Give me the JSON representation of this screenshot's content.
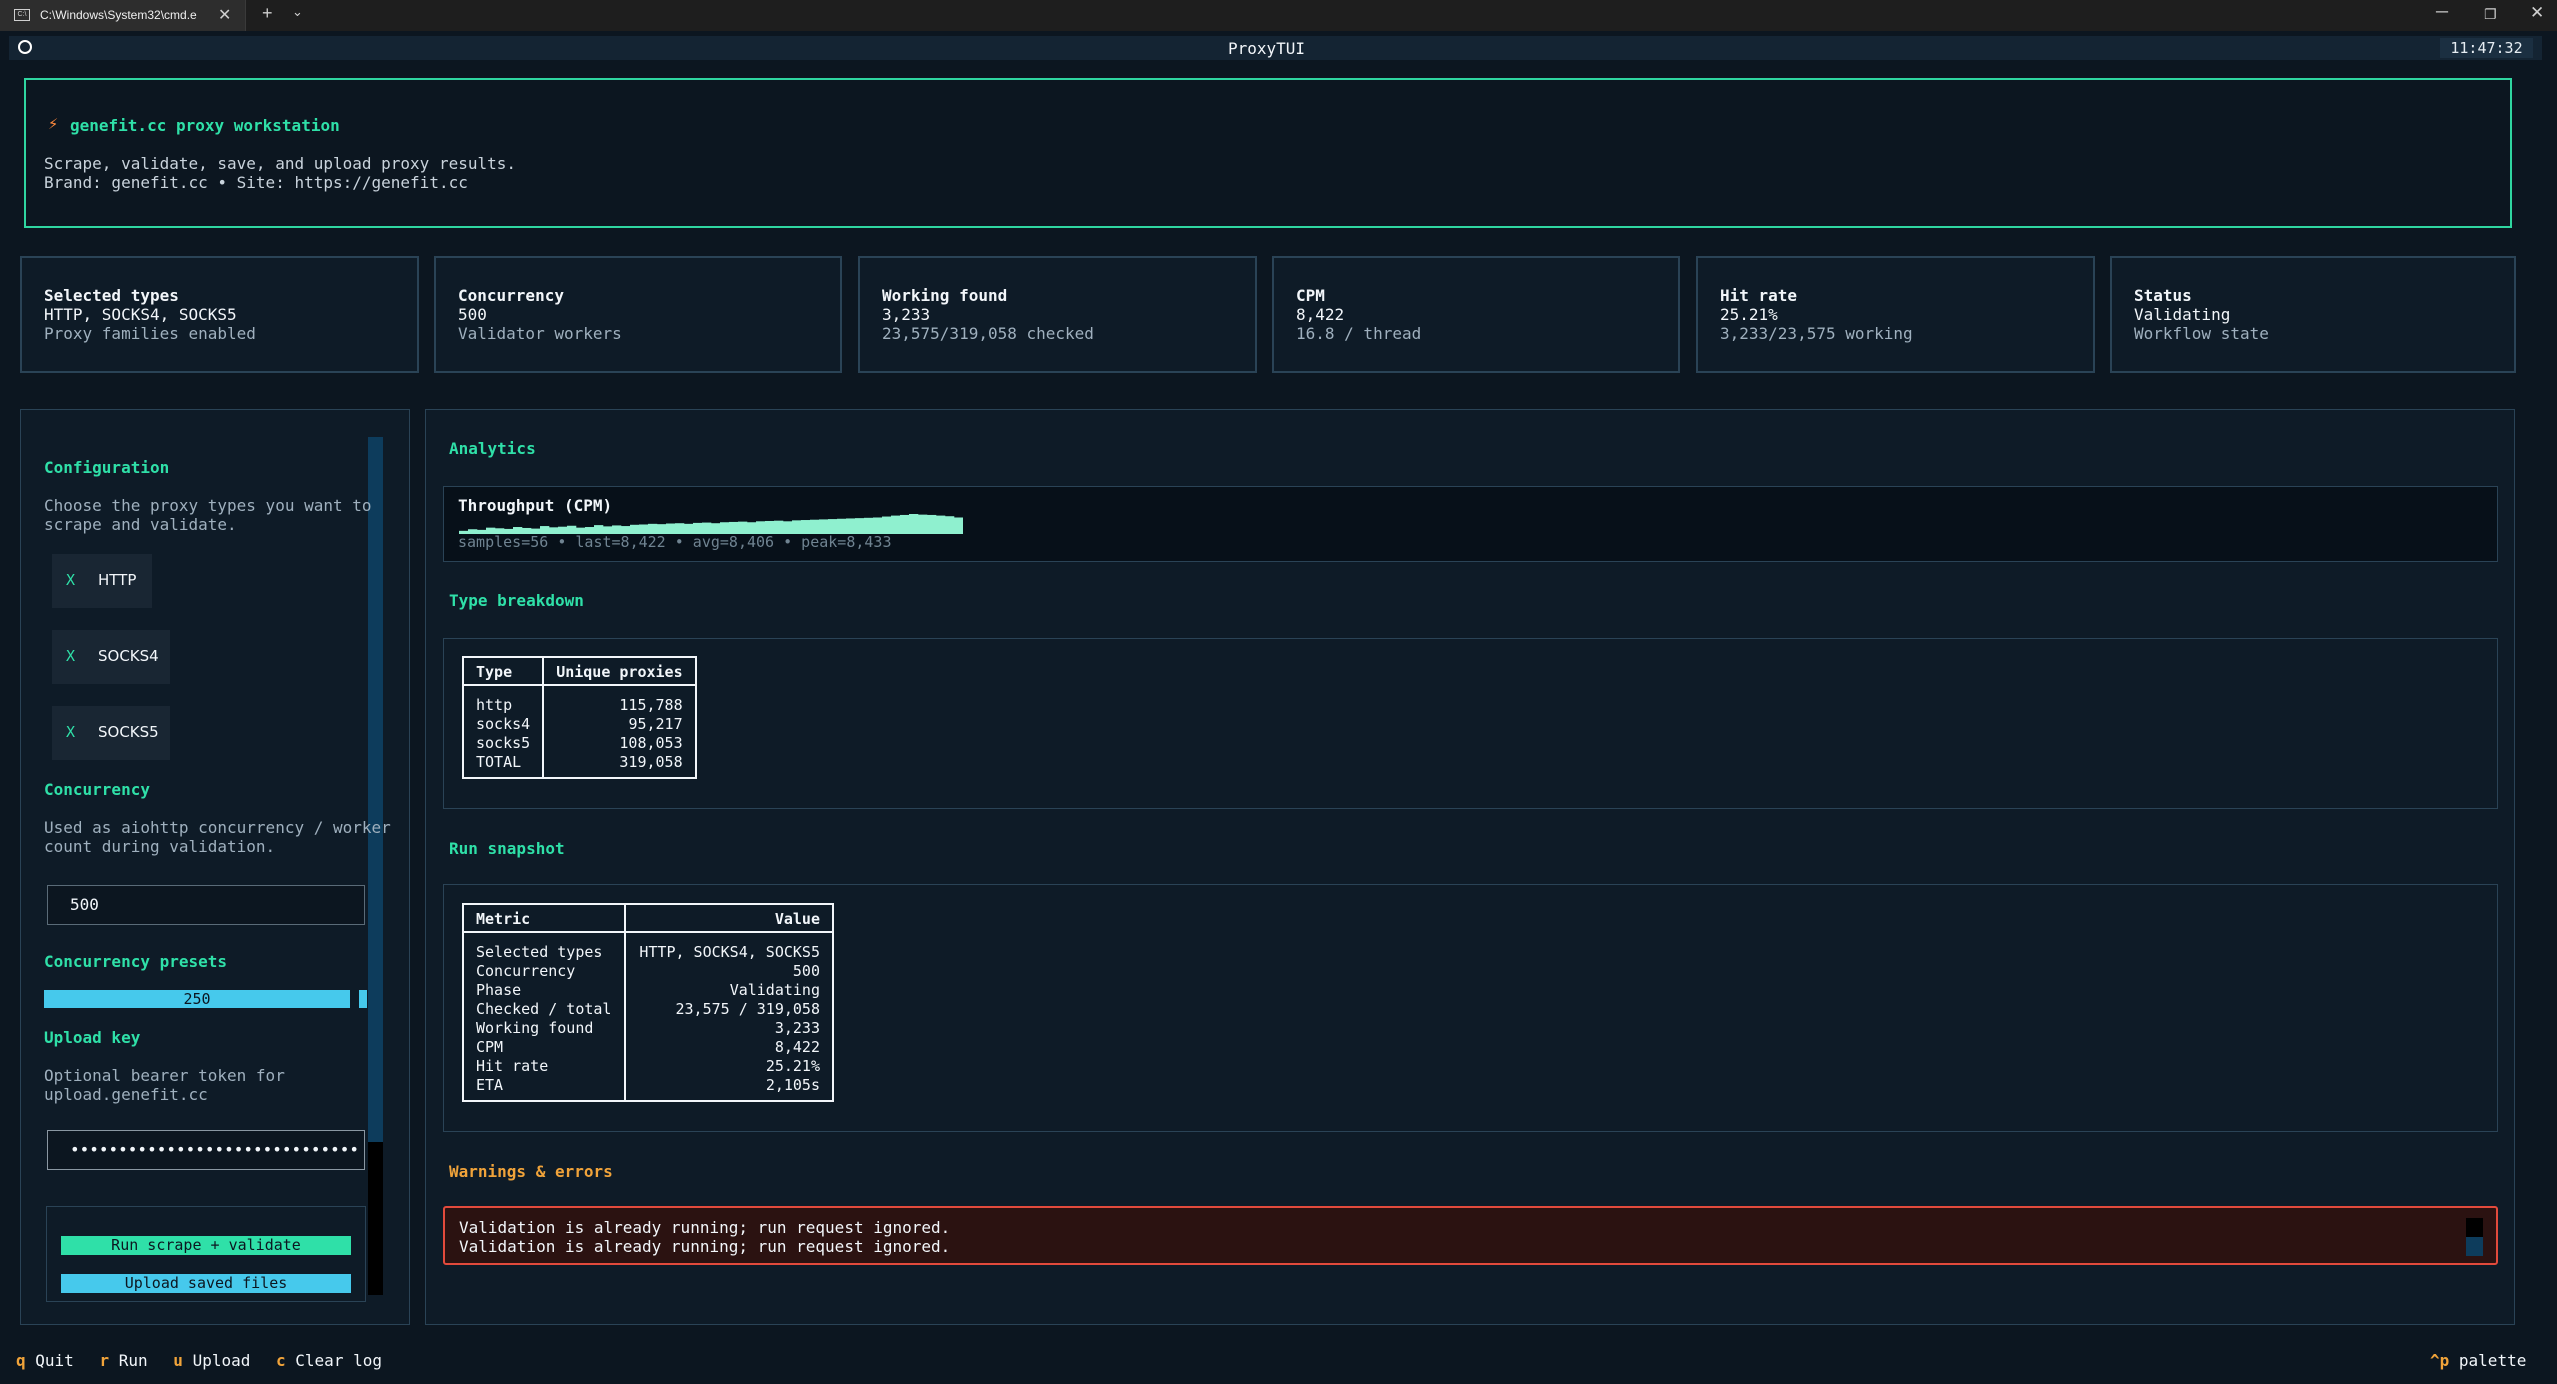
{
  "window": {
    "tab_title": "C:\\Windows\\System32\\cmd.e",
    "tab_icon": "terminal-icon",
    "new_tab": "+",
    "dropdown": "⌄",
    "close_tab": "✕",
    "minimize": "─",
    "maximize": "❐",
    "close": "✕"
  },
  "header": {
    "title": "ProxyTUI",
    "clock": "11:47:32"
  },
  "hero": {
    "bolt": "⚡",
    "title": "genefit.cc proxy workstation",
    "line1": "Scrape, validate, save, and upload proxy results.",
    "line2": "Brand: genefit.cc • Site: https://genefit.cc"
  },
  "stats": [
    {
      "title": "Selected types",
      "value": "HTTP, SOCKS4, SOCKS5",
      "sub": "Proxy families enabled"
    },
    {
      "title": "Concurrency",
      "value": "500",
      "sub": "Validator workers"
    },
    {
      "title": "Working found",
      "value": "3,233",
      "sub": "23,575/319,058 checked"
    },
    {
      "title": "CPM",
      "value": "8,422",
      "sub": "16.8 / thread"
    },
    {
      "title": "Hit rate",
      "value": "25.21%",
      "sub": "3,233/23,575 working"
    },
    {
      "title": "Status",
      "value": "Validating",
      "sub": "Workflow state"
    }
  ],
  "sidebar": {
    "config_title": "Configuration",
    "config_desc1": "Choose the proxy types you want to",
    "config_desc2": "scrape and validate.",
    "types": [
      {
        "mark": "X",
        "label": "HTTP"
      },
      {
        "mark": "X",
        "label": "SOCKS4"
      },
      {
        "mark": "X",
        "label": "SOCKS5"
      }
    ],
    "concurrency_title": "Concurrency",
    "concurrency_desc1": "Used as aiohttp concurrency / worker",
    "concurrency_desc2": "count during validation.",
    "concurrency_value": "500",
    "presets_title": "Concurrency presets",
    "preset_value": "250",
    "upload_key_title": "Upload key",
    "upload_key_desc1": "Optional bearer token for",
    "upload_key_desc2": "upload.genefit.cc",
    "upload_key_value": "••••••••••••••••••••••••••••••",
    "run_button": "Run scrape + validate",
    "upload_button": "Upload saved files"
  },
  "analytics": {
    "title": "Analytics",
    "throughput_title": "Throughput (CPM)",
    "throughput_stats": "samples=56 • last=8,422 • avg=8,406 • peak=8,433",
    "type_breakdown_title": "Type breakdown",
    "type_table": {
      "headers": [
        "Type",
        "Unique proxies"
      ],
      "rows": [
        [
          "http",
          "115,788"
        ],
        [
          "socks4",
          "95,217"
        ],
        [
          "socks5",
          "108,053"
        ],
        [
          "TOTAL",
          "319,058"
        ]
      ]
    },
    "run_snapshot_title": "Run snapshot",
    "snapshot_table": {
      "headers": [
        "Metric",
        "Value"
      ],
      "rows": [
        [
          "Selected types",
          "HTTP, SOCKS4, SOCKS5"
        ],
        [
          "Concurrency",
          "500"
        ],
        [
          "Phase",
          "Validating"
        ],
        [
          "Checked / total",
          "23,575 / 319,058"
        ],
        [
          "Working found",
          "3,233"
        ],
        [
          "CPM",
          "8,422"
        ],
        [
          "Hit rate",
          "25.21%"
        ],
        [
          "ETA",
          "2,105s"
        ]
      ]
    },
    "warnings_title": "Warnings & errors",
    "warnings": [
      "Validation is already running; run request ignored.",
      "Validation is already running; run request ignored."
    ]
  },
  "chart_data": {
    "type": "area",
    "title": "Throughput (CPM)",
    "xlabel": "",
    "ylabel": "",
    "samples": 56,
    "last": 8422,
    "avg": 8406,
    "peak": 8433,
    "series": [
      {
        "values": [
          8380,
          8385,
          8383,
          8390,
          8388,
          8386,
          8392,
          8389,
          8387,
          8395,
          8391,
          8393,
          8396,
          8390,
          8392,
          8398,
          8394,
          8397,
          8395,
          8399,
          8400,
          8402,
          8401,
          8403,
          8404,
          8402,
          8405,
          8406,
          8404,
          8407,
          8408,
          8409,
          8407,
          8410,
          8411,
          8412,
          8410,
          8413,
          8414,
          8415,
          8416,
          8417,
          8418,
          8419,
          8420,
          8421,
          8422,
          8425,
          8428,
          8430,
          8433,
          8431,
          8430,
          8428,
          8426,
          8422
        ]
      }
    ],
    "ylim": [
      8370,
      8433
    ]
  },
  "footer": {
    "keys": [
      {
        "key": "q",
        "label": "Quit"
      },
      {
        "key": "r",
        "label": "Run"
      },
      {
        "key": "u",
        "label": "Upload"
      },
      {
        "key": "c",
        "label": "Clear log"
      }
    ],
    "palette_key": "^p",
    "palette_label": "palette"
  },
  "colors": {
    "accent": "#2fe0a8",
    "button_blue": "#46c9ec",
    "warning": "#f0a33a",
    "error_border": "#e24a3c",
    "background": "#0c1620"
  }
}
